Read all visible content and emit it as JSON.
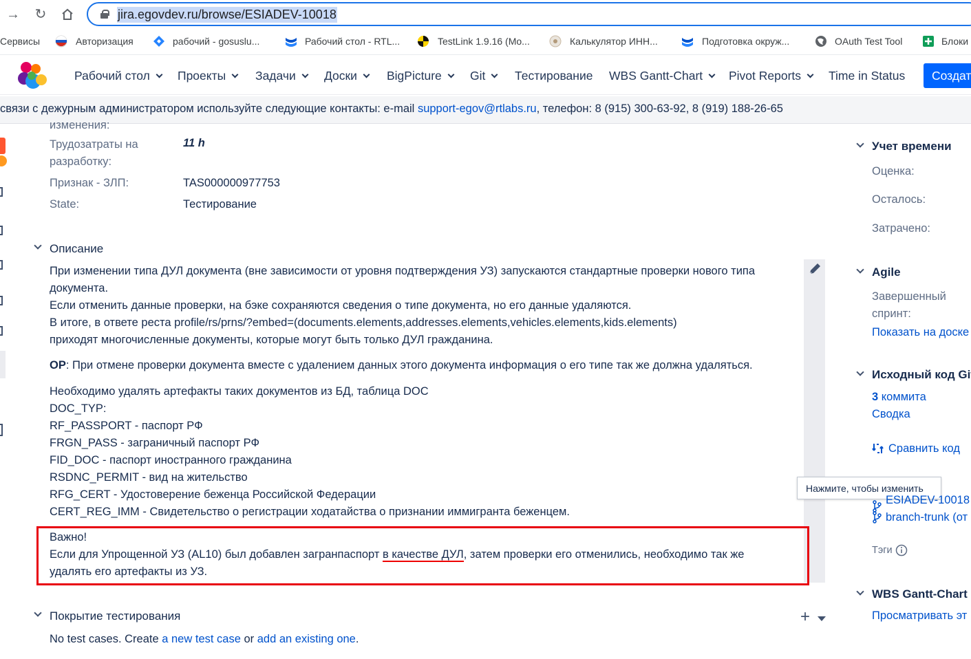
{
  "browser": {
    "url": "jira.egovdev.ru/browse/ESIADEV-10018",
    "bookmarks": [
      {
        "label": "Сервисы"
      },
      {
        "label": "Авторизация"
      },
      {
        "label": "рабочий - gosuslu..."
      },
      {
        "label": "Рабочий стол - RTL..."
      },
      {
        "label": "TestLink 1.9.16 (Mo..."
      },
      {
        "label": "Калькулятор ИНН..."
      },
      {
        "label": "Подготовка окруж..."
      },
      {
        "label": "OAuth Test Tool"
      },
      {
        "label": "Блоки"
      }
    ]
  },
  "header": {
    "nav": [
      {
        "label": "Рабочий стол"
      },
      {
        "label": "Проекты"
      },
      {
        "label": "Задачи"
      },
      {
        "label": "Доски"
      },
      {
        "label": "BigPicture"
      },
      {
        "label": "Git"
      },
      {
        "label": "Тестирование"
      },
      {
        "label": "WBS Gantt-Chart"
      },
      {
        "label": "Pivot Reports"
      },
      {
        "label": "Time in Status"
      }
    ],
    "create_label": "Создат"
  },
  "banner": {
    "prefix": "связи с дежурным администратором используйте следующие контакты: e-mail ",
    "email": "support-egov@rtlabs.ru",
    "suffix": ", телефон: 8 (915) 300-63-92, 8 (919) 188-26-65"
  },
  "details": {
    "cut_label": "изменения:",
    "effort_label_1": "Трудозатраты на",
    "effort_label_2": "разработку:",
    "effort_value": "11 h",
    "zlp_label": "Признак - ЗЛП:",
    "zlp_value": "TAS000000977753",
    "state_label": "State:",
    "state_value": "Тестирование"
  },
  "description": {
    "heading": "Описание",
    "p1": [
      "При изменении типа ДУЛ документа (вне зависимости от уровня подтверждения УЗ) запускаются стандартные проверки нового типа",
      "документа.",
      "Если отменить данные проверки, на бэке сохраняются сведения о типе документа, но его данные удаляются.",
      "В итоге, в ответе реста profile/rs/prns/?embed=(documents.elements,addresses.elements,vehicles.elements,kids.elements)",
      "приходят многочисленные документы, которые могут быть только ДУЛ гражданина."
    ],
    "or_bold": "ОР",
    "or_text": ": При отмене проверки документа вместе с удалением данных этого документа информация о его типе так же должна удаляться.",
    "p3": [
      "Необходимо удалять артефакты таких документов из БД, таблица DOC",
      "DOC_TYP:",
      "RF_PASSPORT - паспорт РФ",
      "FRGN_PASS - заграничный паспорт РФ",
      "FID_DOC - паспорт иностранного гражданина",
      "RSDNC_PERMIT - вид на жительство",
      "RFG_CERT - Удостоверение беженца Российской Федерации",
      "CERT_REG_IMM - Свидетельство о регистрации ходатайства о признании иммигранта беженцем."
    ],
    "important_title": "Важно!",
    "important_pre": "Если для Упрощенной УЗ (AL10) был добавлен загранпаспорт ",
    "important_underlined": "в качестве ДУЛ",
    "important_post": ", затем проверки его отменились, необходимо так же",
    "important_line2": "удалять его артефакты из УЗ.",
    "edit_tooltip": "Нажмите, чтобы изменить"
  },
  "testing": {
    "heading": "Покрытие тестирования",
    "text_pre": "No test cases. Create ",
    "link1": "a new test case",
    "text_mid": " or ",
    "link2": "add an existing one",
    "text_post": "."
  },
  "sidebar": {
    "time_heading": "Учет времени",
    "estimate": "Оценка:",
    "remaining": "Осталось:",
    "spent": "Затрачено:",
    "agile_heading": "Agile",
    "sprint_label_1": "Завершенный",
    "sprint_label_2": "спринт:",
    "board_link": "Показать на доске",
    "git_heading": "Исходный код Git",
    "commits_count": "3",
    "commits_label": " коммита",
    "summary_link": "Сводка",
    "compare_link": "Сравнить код",
    "branch1": "ESIADEV-10018",
    "branch2": "branch-trunk (от",
    "tags_label": "Тэги",
    "wbs_heading": "WBS Gantt-Chart",
    "wbs_link": "Просматривать эт"
  },
  "colors": {
    "accent": "#0052cc",
    "create_button": "#0065ff",
    "highlight_box": "#e8000e"
  }
}
